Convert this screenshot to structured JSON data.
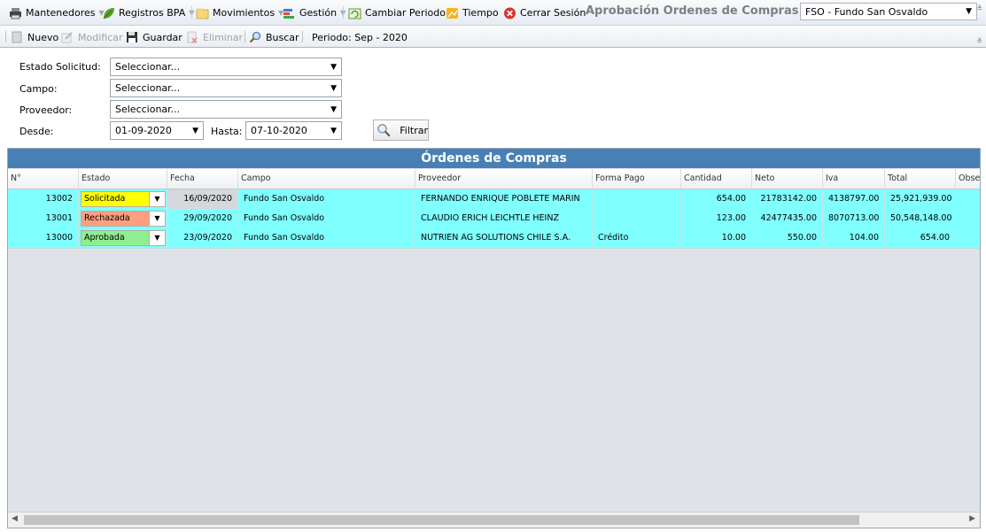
{
  "menu": {
    "mantenedores": "Mantenedores",
    "registros": "Registros BPA",
    "movimientos": "Movimientos",
    "gestion": "Gestión",
    "cambiar_periodo": "Cambiar Periodo",
    "tiempo": "Tiempo",
    "cerrar_sesion": "Cerrar Sesión",
    "page_title": "Aprobación Ordenes de Compras",
    "fundo_selected": "FSO - Fundo San Osvaldo"
  },
  "toolbar": {
    "nuevo": "Nuevo",
    "modificar": "Modificar",
    "guardar": "Guardar",
    "eliminar": "Eliminar",
    "buscar": "Buscar",
    "periodo": "Periodo: Sep - 2020"
  },
  "filters": {
    "estado_label": "Estado Solicitud:",
    "estado_value": "Seleccionar...",
    "campo_label": "Campo:",
    "campo_value": "Seleccionar...",
    "proveedor_label": "Proveedor:",
    "proveedor_value": "Seleccionar...",
    "desde_label": "Desde:",
    "desde_value": "01-09-2020",
    "hasta_label": "Hasta:",
    "hasta_value": "07-10-2020",
    "filtrar": "Filtrar"
  },
  "grid": {
    "title": "Órdenes de Compras",
    "columns": [
      "N°",
      "Estado",
      "Fecha",
      "Campo",
      "Proveedor",
      "Forma Pago",
      "Cantidad",
      "Neto",
      "Iva",
      "Total",
      "Observ"
    ],
    "rows": [
      {
        "n": "13002",
        "estado": "Solicitada",
        "estado_color": "#ffff00",
        "fecha": "16/09/2020",
        "campo": "Fundo San Osvaldo",
        "proveedor": "FERNANDO ENRIQUE POBLETE MARIN",
        "forma_pago": "",
        "cantidad": "654.00",
        "neto": "21783142.00",
        "iva": "4138797.00",
        "total": "25,921,939.00"
      },
      {
        "n": "13001",
        "estado": "Rechazada",
        "estado_color": "#ff9e80",
        "fecha": "29/09/2020",
        "campo": "Fundo San Osvaldo",
        "proveedor": "CLAUDIO ERICH LEICHTLE HEINZ",
        "forma_pago": "",
        "cantidad": "123.00",
        "neto": "42477435.00",
        "iva": "8070713.00",
        "total": "50,548,148.00"
      },
      {
        "n": "13000",
        "estado": "Aprobada",
        "estado_color": "#90ee90",
        "fecha": "23/09/2020",
        "campo": "Fundo San Osvaldo",
        "proveedor": "NUTRIEN AG SOLUTIONS CHILE S.A.",
        "forma_pago": "Crédito",
        "cantidad": "10.00",
        "neto": "550.00",
        "iva": "104.00",
        "total": "654.00"
      }
    ]
  }
}
